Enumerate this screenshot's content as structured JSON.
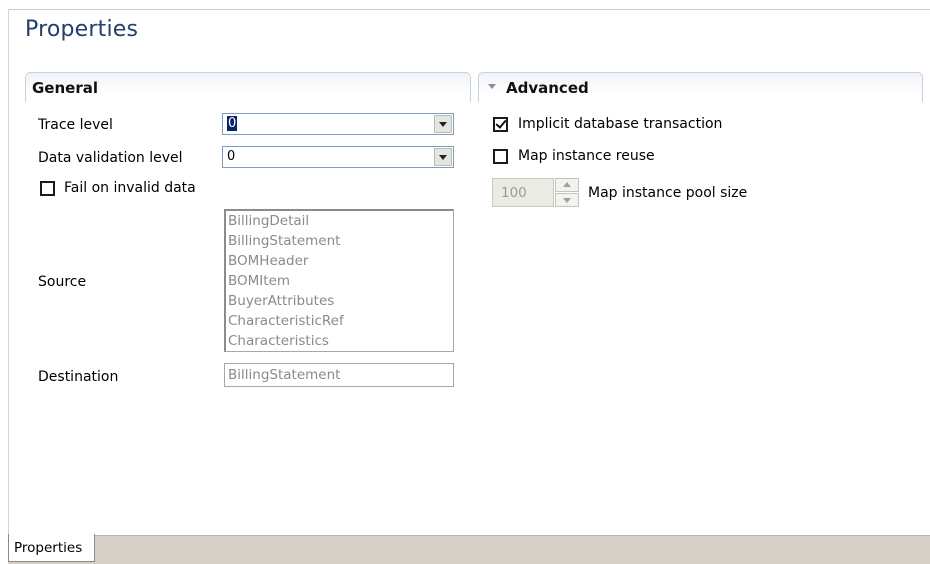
{
  "view": {
    "title": "Properties"
  },
  "general": {
    "header": "General",
    "trace_level": {
      "label": "Trace level",
      "value": "0"
    },
    "data_validation_level": {
      "label": "Data validation level",
      "value": "0"
    },
    "fail_on_invalid_data": {
      "label": "Fail on invalid data",
      "checked": false
    },
    "source": {
      "label": "Source",
      "items": [
        "BillingDetail",
        "BillingStatement",
        "BOMHeader",
        "BOMItem",
        "BuyerAttributes",
        "CharacteristicRef",
        "Characteristics"
      ]
    },
    "destination": {
      "label": "Destination",
      "value": "BillingStatement"
    }
  },
  "advanced": {
    "header": "Advanced",
    "implicit_db_transaction": {
      "label": "Implicit database transaction",
      "checked": true
    },
    "map_instance_reuse": {
      "label": "Map instance reuse",
      "checked": false
    },
    "map_instance_pool_size": {
      "label": "Map instance pool size",
      "value": "100"
    }
  },
  "bottom_tabs": {
    "properties": "Properties"
  },
  "icons": {
    "expand": "chevron-down-icon",
    "dropdown": "dropdown-arrow-icon",
    "spinner": "spinner-arrows-icon"
  },
  "colors": {
    "title": "#22406a",
    "section_border": "#c8d2dc",
    "tab_bar": "#d4d0c8"
  }
}
